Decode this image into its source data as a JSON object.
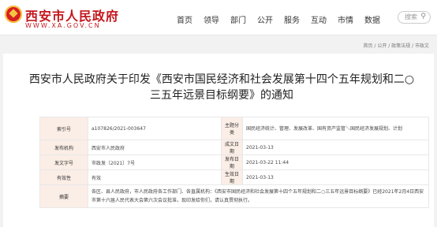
{
  "site": {
    "logo_text": "西安市人民政府",
    "logo_sub": "WWW.XA.GOV.CN"
  },
  "nav": [
    "首页",
    "领导",
    "部门",
    "公开",
    "服务",
    "互动",
    "市情",
    "数据"
  ],
  "search": {
    "placeholder": "搜索",
    "icon": "search-icon"
  },
  "breadcrumb": "首页 / 公开 / 政策法规 / 市政文",
  "article": {
    "title_line1": "西安市人民政府关于印发《西安市国民经济和社会发展第十四个五年规划和二○",
    "title_line2": "三五年远景目标纲要》的通知"
  },
  "meta": {
    "index_label": "索引号",
    "index_value": "a107826/2021-003647",
    "topic_label": "主题分类",
    "topic_value": "国民经济统计、管理、发展改革、国有资产监管＼国民经济发展规划、计划",
    "publisher_label": "发布机构",
    "publisher_value": "西安市人民政府",
    "written_label": "成文日期",
    "written_value": "2021-03-13",
    "docno_label": "发文字号",
    "docno_value": "市政发〔2021〕7号",
    "pubdate_label": "发布日期",
    "pubdate_value": "2021-03-22 11:44",
    "validity_label": "有效性",
    "validity_value": "有效",
    "effective_label": "生效日期",
    "effective_value": "2021-03-13",
    "summary_label": "摘要",
    "summary_value": "各区、县人民政府，市人民政府各工作部门、各直属机构：《西安市国民经济和社会发展第十四个五年规划和二○三五年远景目标纲要》已经2021年2月4日西安市第十六届人民代表大会第六次会议批准，现印发给你们，请认真贯彻执行。"
  }
}
